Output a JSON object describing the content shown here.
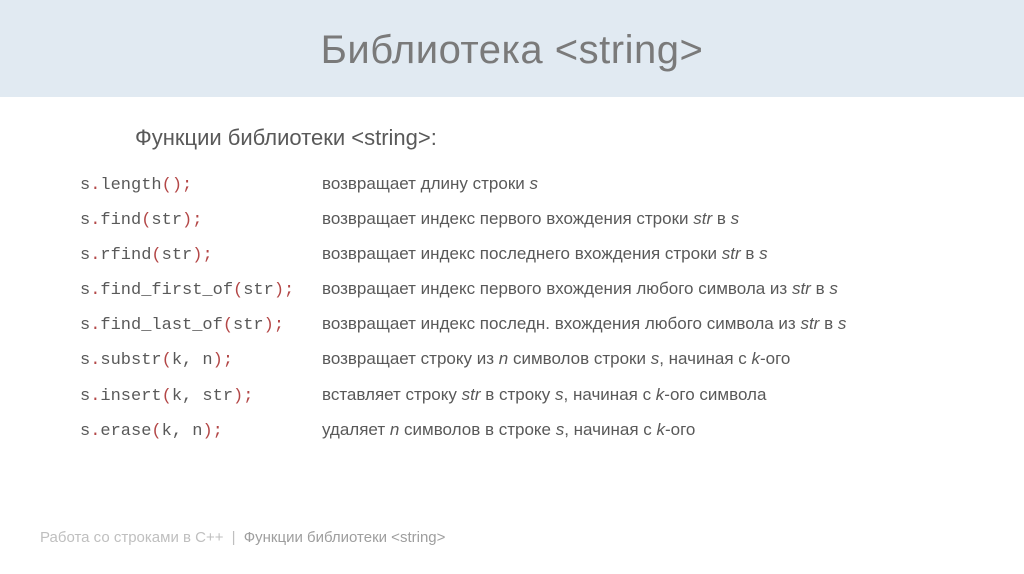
{
  "title": "Библиотека <string>",
  "subtitle": "Функции библиотеки <string>:",
  "rows": [
    {
      "obj": "s",
      "dot": ".",
      "fn": "length",
      "args": "",
      "open": "(",
      "close": ")",
      "semi": ";",
      "desc_parts": [
        {
          "t": "возвращает длину строки "
        },
        {
          "t": "s",
          "i": true
        }
      ]
    },
    {
      "obj": "s",
      "dot": ".",
      "fn": "find",
      "args": "str",
      "open": "(",
      "close": ")",
      "semi": ";",
      "desc_parts": [
        {
          "t": "возвращает индекс первого вхождения строки "
        },
        {
          "t": "str",
          "i": true
        },
        {
          "t": " в "
        },
        {
          "t": "s",
          "i": true
        }
      ]
    },
    {
      "obj": "s",
      "dot": ".",
      "fn": "rfind",
      "args": "str",
      "open": "(",
      "close": ")",
      "semi": ";",
      "desc_parts": [
        {
          "t": "возвращает индекс последнего вхождения строки "
        },
        {
          "t": "str",
          "i": true
        },
        {
          "t": " в "
        },
        {
          "t": "s",
          "i": true
        }
      ]
    },
    {
      "obj": "s",
      "dot": ".",
      "fn": "find_first_of",
      "args": "str",
      "open": "(",
      "close": ")",
      "semi": ";",
      "desc_parts": [
        {
          "t": "возвращает индекс первого вхождения любого символа из "
        },
        {
          "t": "str",
          "i": true
        },
        {
          "t": " в "
        },
        {
          "t": "s",
          "i": true
        }
      ]
    },
    {
      "obj": "s",
      "dot": ".",
      "fn": "find_last_of",
      "args": "str",
      "open": "(",
      "close": ")",
      "semi": ";",
      "desc_parts": [
        {
          "t": "возвращает индекс последн. вхождения любого символа из "
        },
        {
          "t": "str",
          "i": true
        },
        {
          "t": " в "
        },
        {
          "t": "s",
          "i": true
        }
      ]
    },
    {
      "obj": "s",
      "dot": ".",
      "fn": "substr",
      "args": "k, n",
      "open": "(",
      "close": ")",
      "semi": ";",
      "desc_parts": [
        {
          "t": "возвращает строку из "
        },
        {
          "t": "n",
          "i": true
        },
        {
          "t": " символов строки "
        },
        {
          "t": "s",
          "i": true
        },
        {
          "t": ", начиная с "
        },
        {
          "t": "k",
          "i": true
        },
        {
          "t": "-ого"
        }
      ]
    },
    {
      "obj": "s",
      "dot": ".",
      "fn": "insert",
      "args": "k, str",
      "open": "(",
      "close": ")",
      "semi": ";",
      "desc_parts": [
        {
          "t": "вставляет строку "
        },
        {
          "t": "str",
          "i": true
        },
        {
          "t": " в строку "
        },
        {
          "t": "s",
          "i": true
        },
        {
          "t": ", начиная с "
        },
        {
          "t": "k",
          "i": true
        },
        {
          "t": "-ого символа"
        }
      ]
    },
    {
      "obj": "s",
      "dot": ".",
      "fn": "erase",
      "args": "k, n",
      "open": "(",
      "close": ")",
      "semi": ";",
      "desc_parts": [
        {
          "t": "удаляет "
        },
        {
          "t": "n",
          "i": true
        },
        {
          "t": " символов в строке "
        },
        {
          "t": "s",
          "i": true
        },
        {
          "t": ", начиная с "
        },
        {
          "t": "k",
          "i": true
        },
        {
          "t": "-ого"
        }
      ]
    }
  ],
  "footer": {
    "crumb1": "Работа со строками в C++",
    "sep": "|",
    "crumb2": "Функции библиотеки <string>"
  }
}
